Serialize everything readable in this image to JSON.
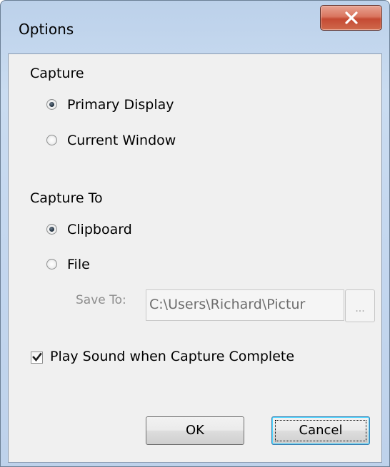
{
  "window": {
    "title": "Options"
  },
  "capture": {
    "heading": "Capture",
    "options": [
      {
        "label": "Primary Display",
        "selected": true
      },
      {
        "label": "Current Window",
        "selected": false
      }
    ]
  },
  "capture_to": {
    "heading": "Capture To",
    "options": [
      {
        "label": "Clipboard",
        "selected": true
      },
      {
        "label": "File",
        "selected": false
      }
    ],
    "save_to_label": "Save To:",
    "save_to_value": "C:\\Users\\Richard\\Pictur",
    "browse_label": "..."
  },
  "play_sound": {
    "label": "Play Sound when Capture Complete",
    "checked": true
  },
  "buttons": {
    "ok": "OK",
    "cancel": "Cancel"
  },
  "colors": {
    "close_button": "#c54a33",
    "frame": "#c3d6ee",
    "client_background": "#f0f0f0"
  }
}
